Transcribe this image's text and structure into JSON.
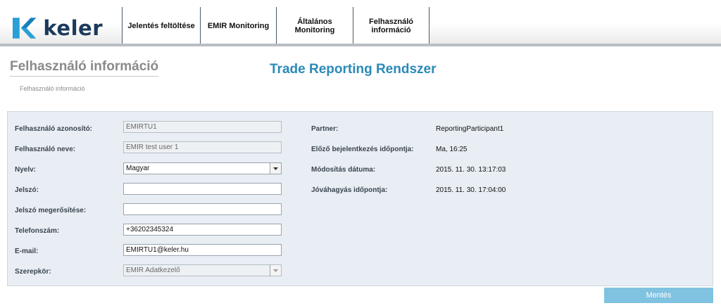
{
  "brand": {
    "name": "keler"
  },
  "nav": {
    "tabs": [
      {
        "label_line1": "Jelentés feltöltése",
        "label_line2": ""
      },
      {
        "label_line1": "EMIR Monitoring",
        "label_line2": ""
      },
      {
        "label_line1": "Általános",
        "label_line2": "Monitoring"
      },
      {
        "label_line1": "Felhasználó",
        "label_line2": "információ"
      }
    ]
  },
  "page": {
    "title": "Felhasználó információ",
    "app_title": "Trade Reporting Rendszer",
    "breadcrumb": "Felhasználó információ"
  },
  "form": {
    "user_id": {
      "label": "Felhasználó azonosító:",
      "value": "EMIRTU1"
    },
    "user_name": {
      "label": "Felhasználó neve:",
      "value": "EMIR test user 1"
    },
    "language": {
      "label": "Nyelv:",
      "value": "Magyar"
    },
    "password": {
      "label": "Jelszó:",
      "value": ""
    },
    "password_confirm": {
      "label": "Jelszó megerősítése:",
      "value": ""
    },
    "phone": {
      "label": "Telefonszám:",
      "value": "+36202345324"
    },
    "email": {
      "label": "E-mail:",
      "value": "EMIRTU1@keler.hu"
    },
    "role": {
      "label": "Szerepkör:",
      "value": "EMIR Adatkezelő"
    }
  },
  "info": {
    "partner": {
      "label": "Partner:",
      "value": "ReportingParticipant1"
    },
    "last_login": {
      "label": "Előző bejelentkezés időpontja:",
      "value": "Ma, 16:25"
    },
    "modified": {
      "label": "Módosítás dátuma:",
      "value": "2015. 11. 30. 13:17:03"
    },
    "approved": {
      "label": "Jóváhagyás időpontja:",
      "value": "2015. 11. 30. 17:04:00"
    }
  },
  "actions": {
    "save_label": "Mentés"
  },
  "colors": {
    "accent": "#2a8ab8",
    "button": "#7fc3e0",
    "panel": "#e8eef3",
    "brand_dark": "#1a3a5c"
  }
}
